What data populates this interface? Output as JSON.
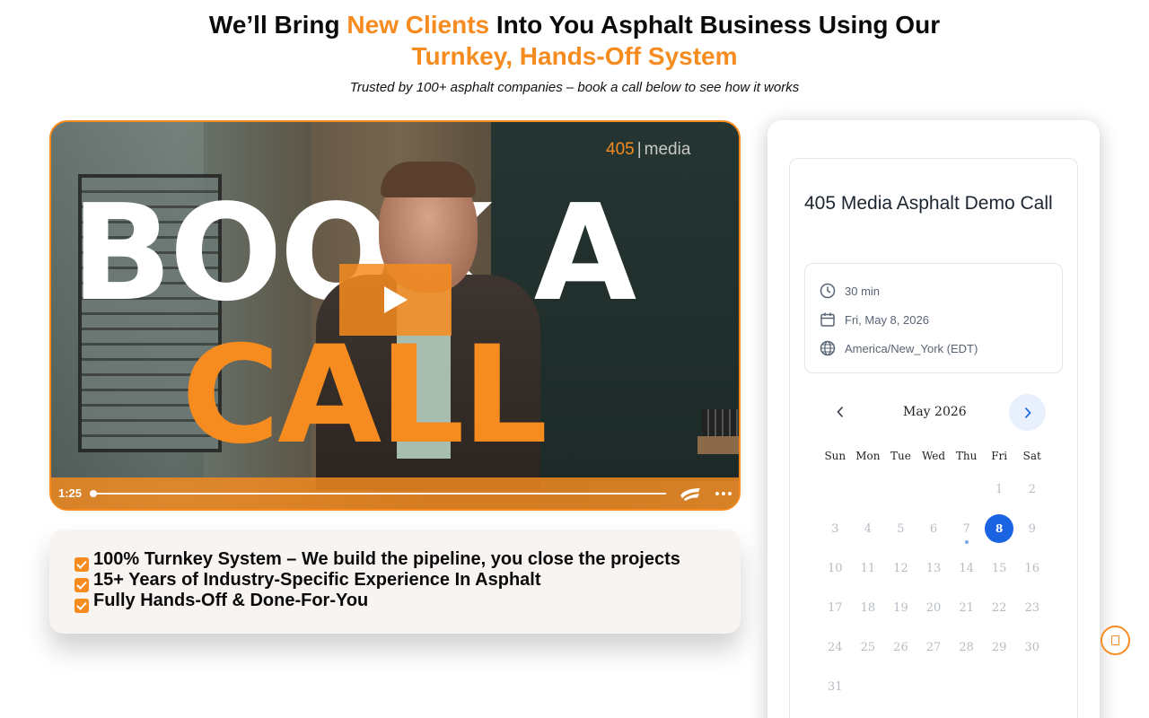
{
  "header": {
    "line1_pre": "We’ll Bring ",
    "line1_accent": "New Clients",
    "line1_post": " Into You Asphalt Business Using Our",
    "line2": "Turnkey, Hands-Off System",
    "subline": "Trusted by 100+ asphalt companies – book a call below to see how it works"
  },
  "video": {
    "brand_left": "405",
    "brand_sep": "|",
    "brand_right": "media",
    "headline_top": "BOOK A",
    "headline_bottom": "CALL",
    "time": "1:25",
    "progress": 0,
    "icons": [
      "play-icon",
      "brand-logo-icon",
      "more-options-icon"
    ]
  },
  "benefits": [
    "100% Turnkey System – We build the pipeline, you close the projects",
    "15+ Years of Industry-Specific Experience In Asphalt",
    "Fully Hands-Off & Done-For-You"
  ],
  "booking": {
    "title": "405 Media Asphalt Demo Call",
    "duration": "30 min",
    "date": "Fri, May 8, 2026",
    "timezone": "America/New_York (EDT)",
    "month": "May 2026",
    "weekdays": [
      "Sun",
      "Mon",
      "Tue",
      "Wed",
      "Thu",
      "Fri",
      "Sat"
    ],
    "weeks": [
      [
        "",
        "",
        "",
        "",
        "",
        "1",
        "2"
      ],
      [
        "3",
        "4",
        "5",
        "6",
        "7",
        "8",
        "9"
      ],
      [
        "10",
        "11",
        "12",
        "13",
        "14",
        "15",
        "16"
      ],
      [
        "17",
        "18",
        "19",
        "20",
        "21",
        "22",
        "23"
      ],
      [
        "24",
        "25",
        "26",
        "27",
        "28",
        "29",
        "30"
      ],
      [
        "31",
        "",
        "",
        "",
        "",
        "",
        ""
      ]
    ],
    "selected_day": "8",
    "today": "7"
  },
  "colors": {
    "accent": "#f68b1f",
    "selected": "#1a64e4"
  }
}
